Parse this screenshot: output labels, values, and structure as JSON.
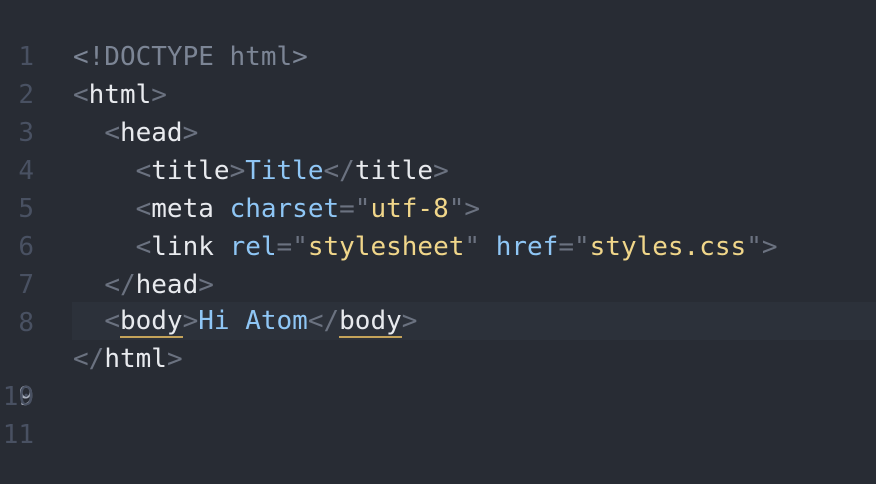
{
  "editor": {
    "line_numbers": [
      "1",
      "2",
      "3",
      "4",
      "5",
      "6",
      "7",
      "8",
      "9",
      "10",
      "11"
    ],
    "active_line": "9",
    "lines": {
      "l2": {
        "doctype": "<!DOCTYPE html>"
      },
      "l3": {
        "open": "<",
        "tag": "html",
        "close": ">"
      },
      "l4": {
        "indent": "  ",
        "open": "<",
        "tag": "head",
        "close": ">"
      },
      "l5": {
        "indent": "    ",
        "open": "<",
        "tag": "title",
        "close": ">",
        "text": "Title",
        "open2": "</",
        "tag2": "title",
        "close2": ">"
      },
      "l6": {
        "indent": "    ",
        "open": "<",
        "tag": "meta",
        "sp": " ",
        "attr": "charset",
        "eq": "=",
        "q1": "\"",
        "val": "utf-8",
        "q2": "\"",
        "close": ">"
      },
      "l7": {
        "indent": "    ",
        "open": "<",
        "tag": "link",
        "sp": " ",
        "attr": "rel",
        "eq": "=",
        "q1": "\"",
        "val": "stylesheet",
        "q2": "\"",
        "sp2": " ",
        "attr2": "href",
        "eq2": "=",
        "q3": "\"",
        "val2": "styles.css",
        "q4": "\"",
        "close": ">"
      },
      "l8": {
        "indent": "  ",
        "open": "</",
        "tag": "head",
        "close": ">"
      },
      "l9": {
        "indent": "  ",
        "open": "<",
        "tag": "body",
        "close": ">",
        "text": "Hi Atom",
        "open2": "</",
        "tag2": "body",
        "close2": ">"
      },
      "l10": {
        "open": "</",
        "tag": "html",
        "close": ">"
      }
    }
  },
  "colors": {
    "background": "#282c34",
    "cursor_line": "#2c313a",
    "gutter": "#495162",
    "tag": "#e8eaee",
    "attribute": "#8fc6f5",
    "string": "#f0d68a",
    "punctuation": "#6b7280",
    "bracket_match_underline": "#c4a35a"
  }
}
